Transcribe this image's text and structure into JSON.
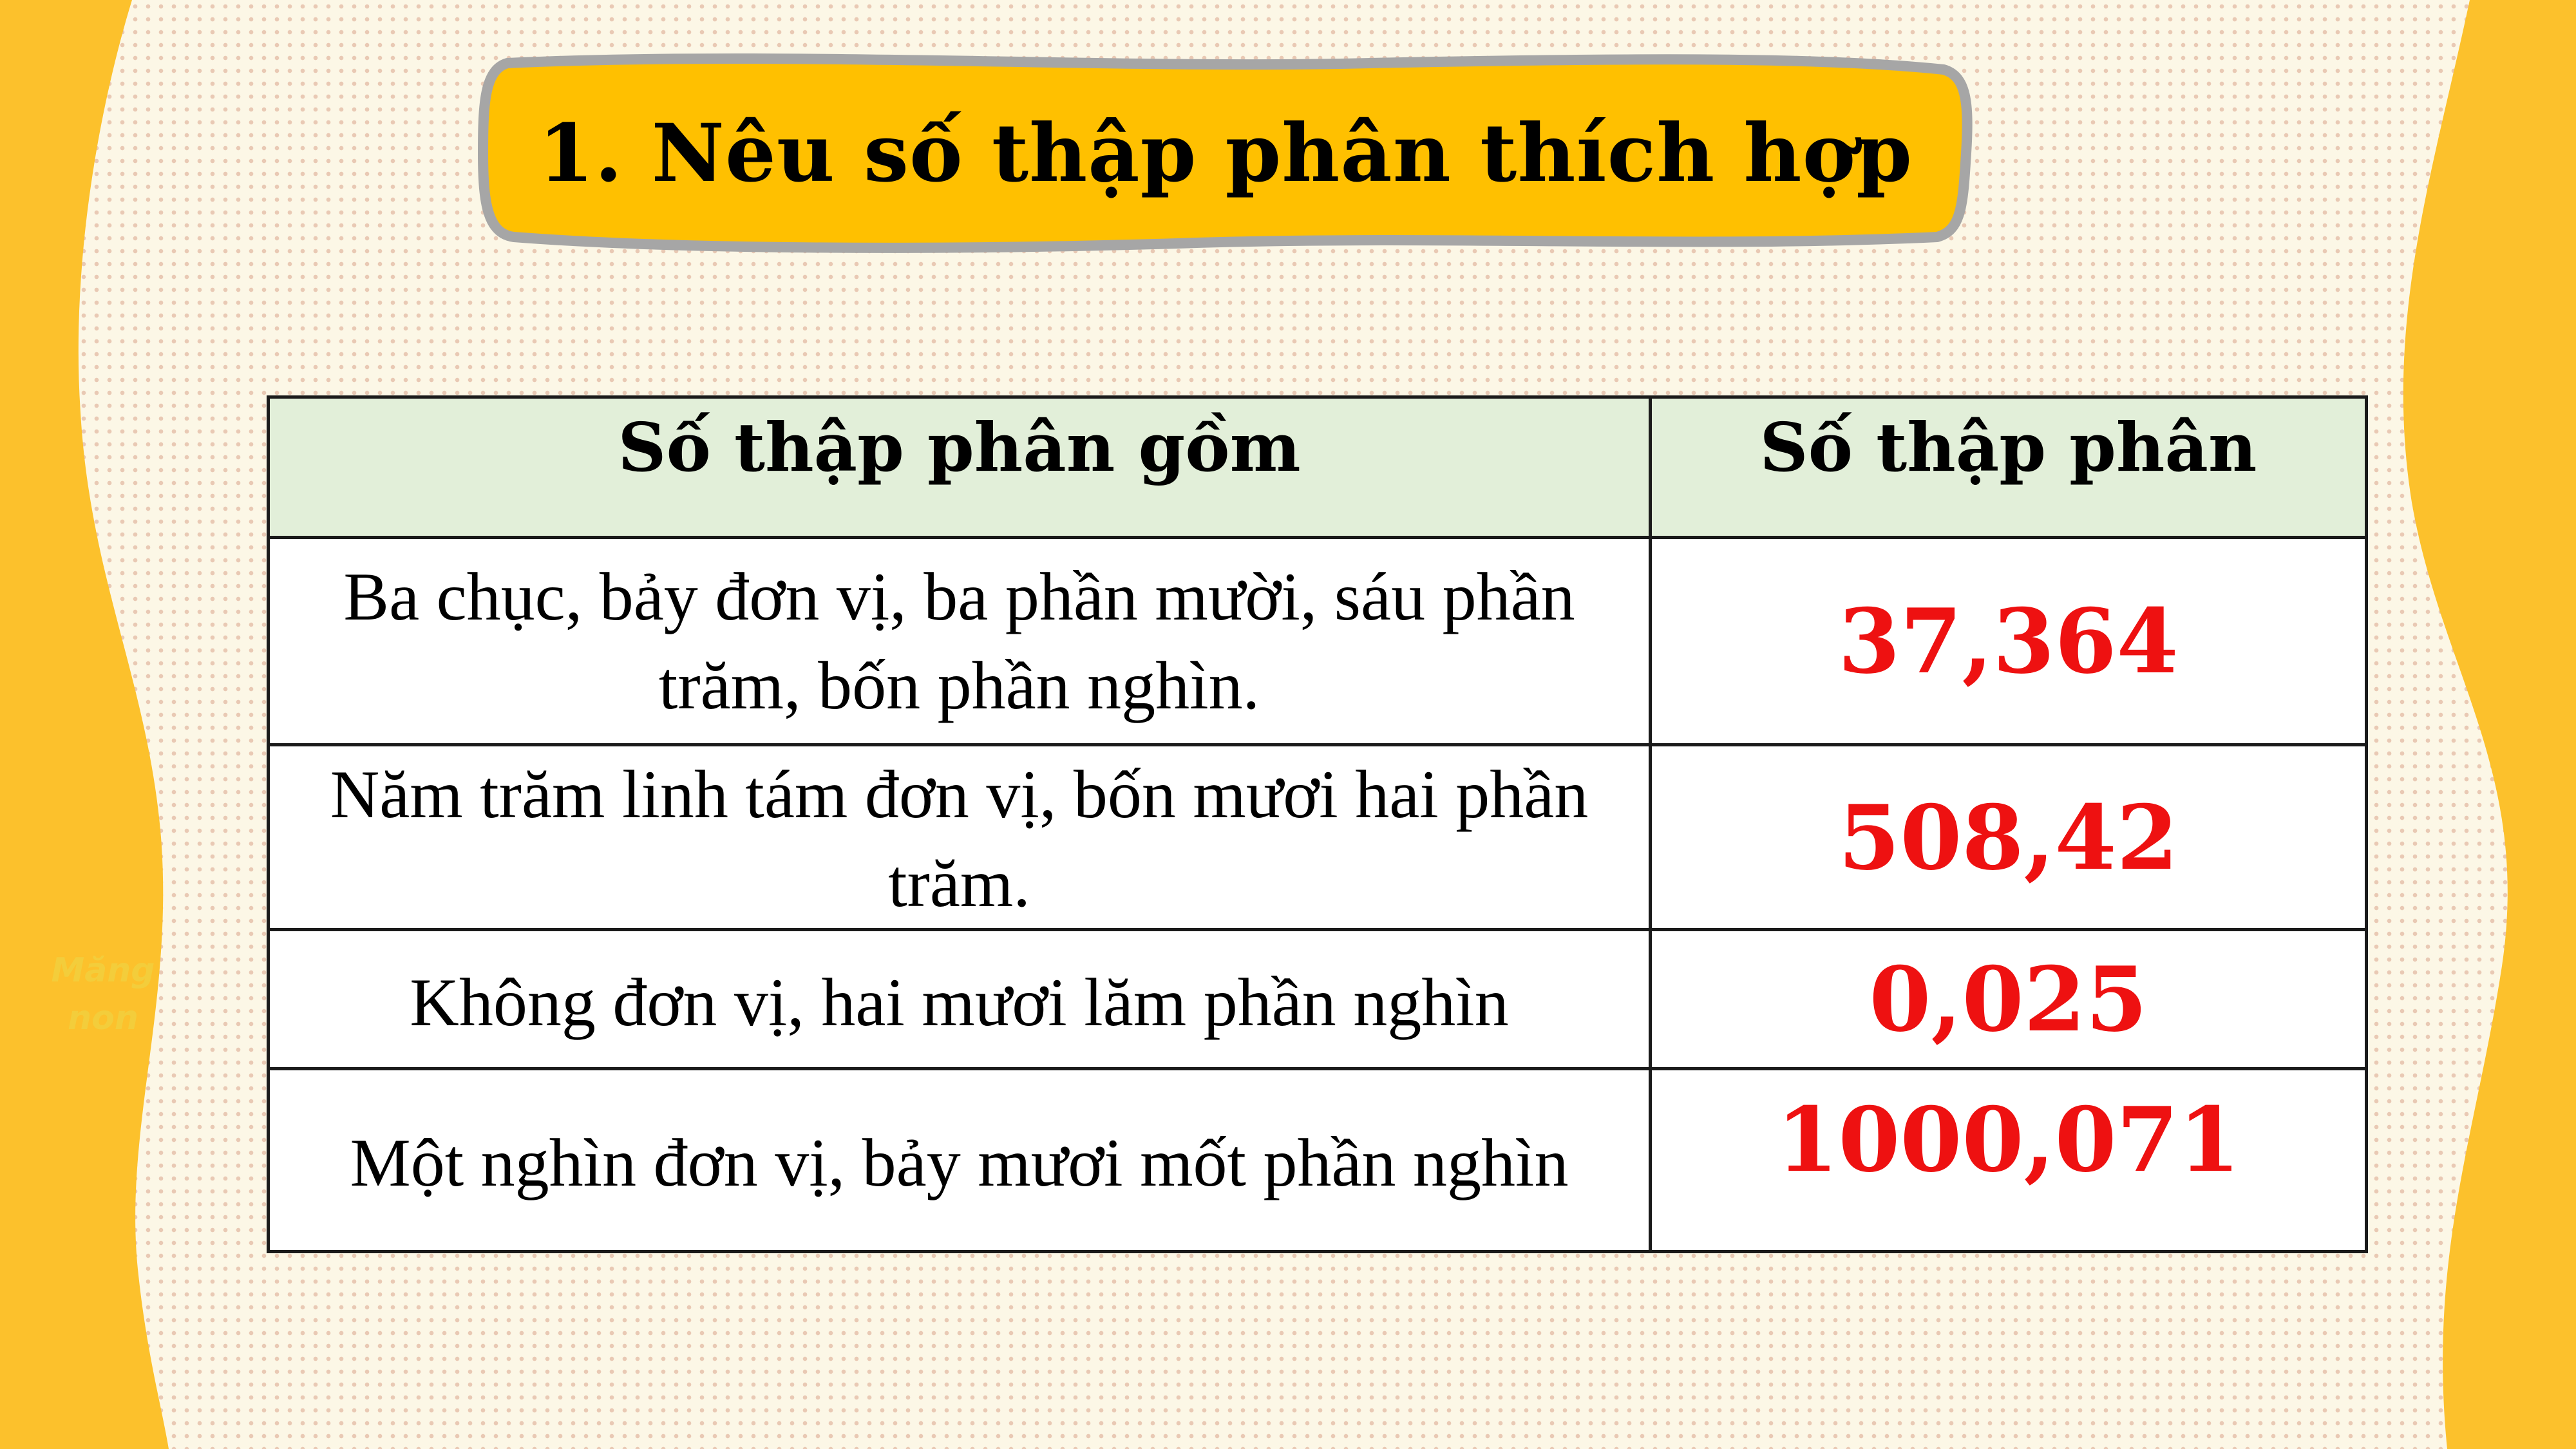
{
  "title": "1. Nêu số thập phân thích hợp",
  "watermark": [
    "Măng",
    "non"
  ],
  "table": {
    "headers": [
      "Số thập phân gồm",
      "Số thập phân"
    ],
    "rows": [
      {
        "description": "Ba chục, bảy đơn vị, ba phần mười, sáu phần trăm, bốn phần nghìn.",
        "value": "37,364"
      },
      {
        "description": "Năm trăm linh tám đơn vị, bốn mươi hai phần trăm.",
        "value": "508,42"
      },
      {
        "description": "Không đơn vị, hai mươi lăm phần nghìn",
        "value": "0,025"
      },
      {
        "description": "Một nghìn đơn vị, bảy mươi mốt phần nghìn",
        "value": "1000,071"
      }
    ]
  },
  "colors": {
    "background": "#fcf7e6",
    "wave": "#fcc12c",
    "banner_fill": "#ffc000",
    "banner_border": "#a6a6a6",
    "header_fill": "#e2efd9",
    "answer_text": "#ee1111"
  }
}
